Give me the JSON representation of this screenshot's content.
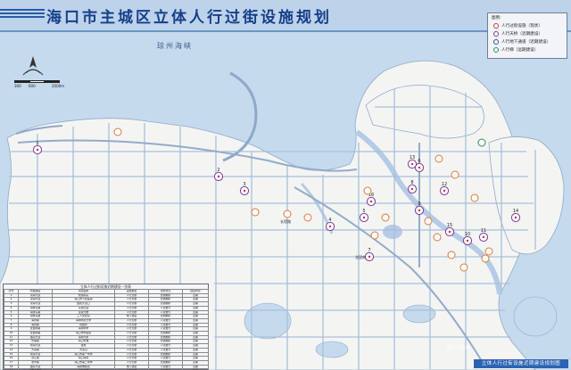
{
  "title": "海口市主城区立体人行过街设施规划",
  "sea_label": "琼州海峡",
  "scale_labels": [
    "300",
    "600",
    "2000m"
  ],
  "legend": {
    "title": "图例:",
    "items": [
      {
        "label": "人行过街设施（现状）",
        "color": "#cc3333"
      },
      {
        "label": "人行天桥（近期建设）",
        "color": "#7b3aa4"
      },
      {
        "label": "人行地下通道（近期建设）",
        "color": "#2a4ca0"
      },
      {
        "label": "人行梯（远期建设）",
        "color": "#2e8b57"
      }
    ]
  },
  "place_labels": [
    "长堤路",
    "龙昆南"
  ],
  "markers": [
    {
      "label": "1",
      "kind": "planned"
    },
    {
      "label": "2",
      "kind": "planned"
    },
    {
      "label": "3",
      "kind": "planned"
    },
    {
      "label": "4",
      "kind": "planned"
    },
    {
      "label": "5",
      "kind": "planned"
    },
    {
      "label": "6",
      "kind": "planned"
    },
    {
      "label": "7",
      "kind": "planned"
    },
    {
      "label": "8",
      "kind": "planned"
    },
    {
      "label": "9",
      "kind": "planned"
    },
    {
      "label": "10",
      "kind": "planned"
    },
    {
      "label": "11",
      "kind": "planned"
    },
    {
      "label": "12",
      "kind": "planned"
    },
    {
      "label": "13",
      "kind": "planned"
    },
    {
      "label": "14",
      "kind": "planned"
    },
    {
      "label": "15",
      "kind": "planned"
    },
    {
      "label": "16",
      "kind": "planned"
    },
    {
      "label": "",
      "kind": "existing"
    },
    {
      "label": "",
      "kind": "existing"
    },
    {
      "label": "",
      "kind": "existing"
    },
    {
      "label": "",
      "kind": "existing"
    },
    {
      "label": "",
      "kind": "existing"
    },
    {
      "label": "",
      "kind": "existing"
    },
    {
      "label": "",
      "kind": "existing"
    },
    {
      "label": "",
      "kind": "existing"
    },
    {
      "label": "",
      "kind": "existing"
    },
    {
      "label": "",
      "kind": "existing"
    },
    {
      "label": "",
      "kind": "existing"
    },
    {
      "label": "",
      "kind": "existing"
    },
    {
      "label": "",
      "kind": "existing"
    },
    {
      "label": "",
      "kind": "existing"
    },
    {
      "label": "",
      "kind": "existing"
    },
    {
      "label": "",
      "kind": "existing"
    },
    {
      "label": "",
      "kind": "long_term"
    }
  ],
  "table": {
    "caption": "立体人行过街设施近期建设一览表",
    "headers": [
      "序号",
      "所在路段",
      "周边设施",
      "设施类型",
      "现状状况",
      "建设时序"
    ],
    "rows": [
      [
        "1",
        "滨海大道",
        "新港码头",
        "人行天桥",
        "交通拥挤",
        "近期"
      ],
      [
        "2",
        "滨海大道",
        "海口市人民医院",
        "人行天桥",
        "交通拥挤",
        "近期"
      ],
      [
        "3",
        "滨海大道",
        "国贸大道口",
        "人行天桥",
        "交通拥挤",
        "近期"
      ],
      [
        "4",
        "海秀东路",
        "东湖公园",
        "人行天桥",
        "人流量大",
        "近期"
      ],
      [
        "5",
        "海秀东路",
        "百货大楼",
        "人行天桥",
        "人流量大",
        "近期"
      ],
      [
        "6",
        "海秀东路",
        "工人文化宫",
        "地下通道",
        "交通拥挤",
        "近期"
      ],
      [
        "7",
        "海府路",
        "海南师范大学",
        "人行天桥",
        "人流量大",
        "近期"
      ],
      [
        "8",
        "海府路",
        "省政府",
        "人行天桥",
        "人流量大",
        "近期"
      ],
      [
        "9",
        "龙昆南路",
        "海南中学",
        "人行天桥",
        "人流量大",
        "近期"
      ],
      [
        "10",
        "龙昆南路",
        "海口市中医院",
        "人行天桥",
        "交通拥挤",
        "近期"
      ],
      [
        "11",
        "国兴大道",
        "海南大厦",
        "人行天桥",
        "交通拥挤",
        "近期"
      ],
      [
        "12",
        "长堤路",
        "海口外滩",
        "人行天桥",
        "交通拥挤",
        "近期"
      ],
      [
        "13",
        "南海大道",
        "金盘",
        "人行天桥",
        "人流量大",
        "近期"
      ],
      [
        "14",
        "大英路",
        "大英山",
        "人行天桥",
        "人流量大",
        "近期"
      ],
      [
        "15",
        "南海大道",
        "海口市第一中学",
        "人行天桥",
        "交通拥挤",
        "近期"
      ],
      [
        "16",
        "滨江路",
        "海口海关",
        "人行天桥",
        "人流量大",
        "近期"
      ],
      [
        "17",
        "龙华路",
        "海口市第二中学",
        "人行天桥",
        "交通拥挤",
        "近期"
      ],
      [
        "18",
        "国兴大道",
        "海南电视台",
        "地下通道",
        "人流量大",
        "近期"
      ],
      [
        "19",
        "海甸五西路",
        "海南大学",
        "人行天桥",
        "人流量大",
        "近期"
      ],
      [
        "20",
        "椰海大道",
        "金盘工业区",
        "人行天桥",
        "交通拥挤",
        "近期"
      ],
      [
        "21",
        "椰海大道",
        "海口市长流",
        "人行天桥",
        "人流量大",
        "近期"
      ]
    ]
  },
  "bottom_label": "立体人行过街设施近期建设规划图",
  "watermark": "海口发布",
  "colors": {
    "title": "#173e8a",
    "header_bg": "#bcd3ea",
    "sea": "#c6daee",
    "land": "#f4f5f3",
    "road": "#a9bfda",
    "water_inland": "#b5cbe6",
    "bottom_label_bg": "#2b63b2"
  }
}
